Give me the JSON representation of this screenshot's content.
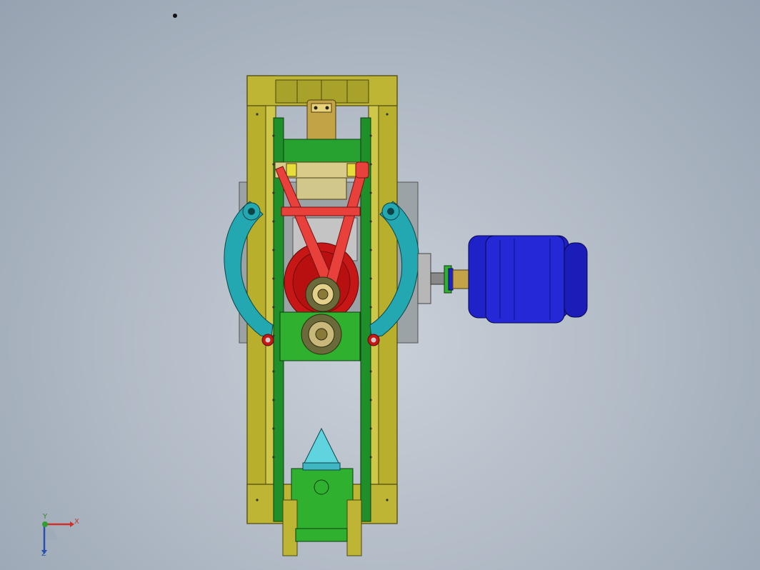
{
  "viewport": {
    "background_top": "#c9d0d8",
    "background_edge": "#96a2b1"
  },
  "triad": {
    "x_label": "X",
    "y_label": "Y",
    "z_label": "Z",
    "x_color": "#d0302a",
    "y_color": "#2fa02f",
    "z_color": "#2a4fb0"
  },
  "model": {
    "frame_color": "#b5ad2a",
    "rail_color": "#1f8f2a",
    "linkage_color": "#e8403a",
    "arm_color": "#23a7b0",
    "wheel_color": "#c71616",
    "motor_color": "#1f22c8",
    "cone_color": "#5fd4df",
    "base_color": "#2fb02f"
  }
}
